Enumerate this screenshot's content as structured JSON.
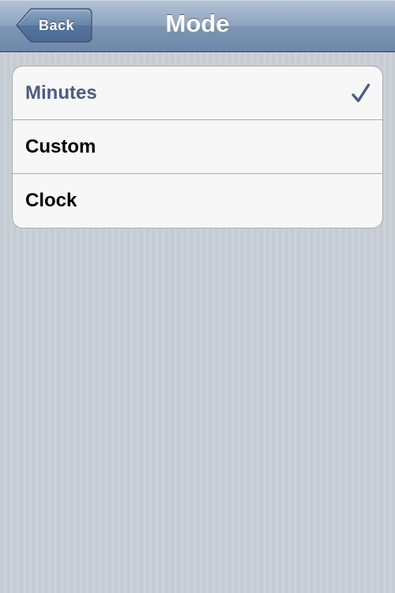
{
  "navbar": {
    "back_label": "Back",
    "title": "Mode"
  },
  "options": [
    {
      "label": "Minutes",
      "selected": true
    },
    {
      "label": "Custom",
      "selected": false
    },
    {
      "label": "Clock",
      "selected": false
    }
  ],
  "colors": {
    "selected_text": "#4c5b82",
    "checkmark": "#4c5b82",
    "navbar": "#7d96b3",
    "background": "#c5ccd4"
  },
  "icons": {
    "checkmark": "checkmark-icon"
  }
}
